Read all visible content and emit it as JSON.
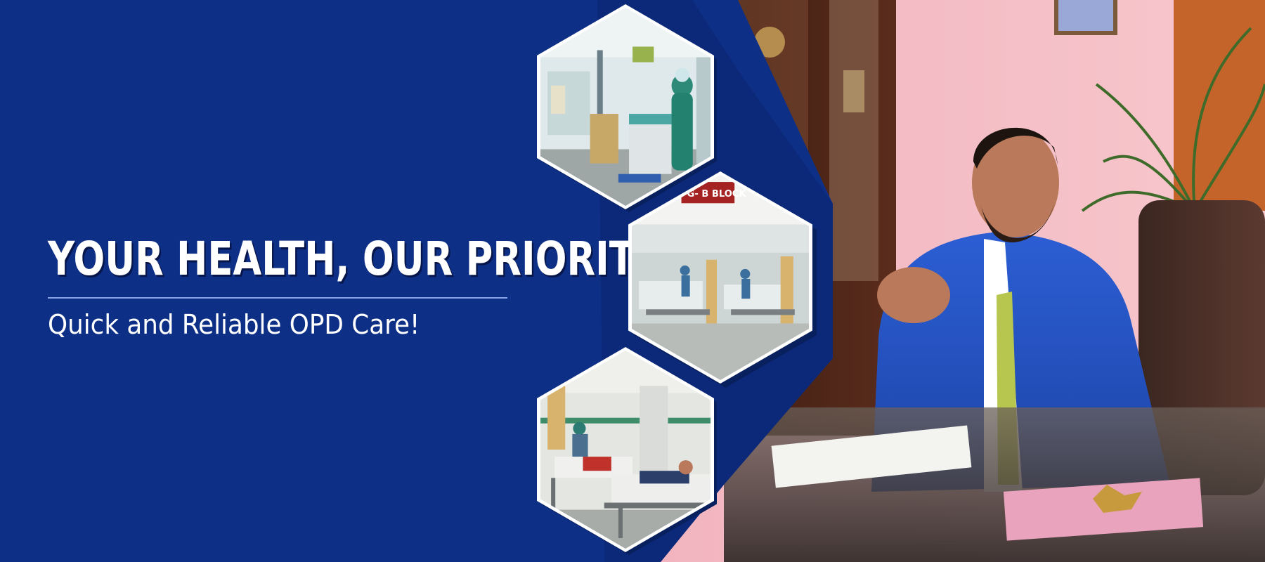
{
  "banner": {
    "headline": "YOUR HEALTH, OUR PRIORITY",
    "tagline": "Quick and Reliable OPD Care!"
  },
  "hex_photos": [
    {
      "name": "neonatal-ward-photo"
    },
    {
      "name": "b-block-ward-photo",
      "sign_text": "G- B BLOCK"
    },
    {
      "name": "patient-ward-photo"
    }
  ],
  "colors": {
    "brand_blue": "#0e2f86",
    "hex_border": "#ffffff",
    "divider": "#8aa2e6"
  }
}
